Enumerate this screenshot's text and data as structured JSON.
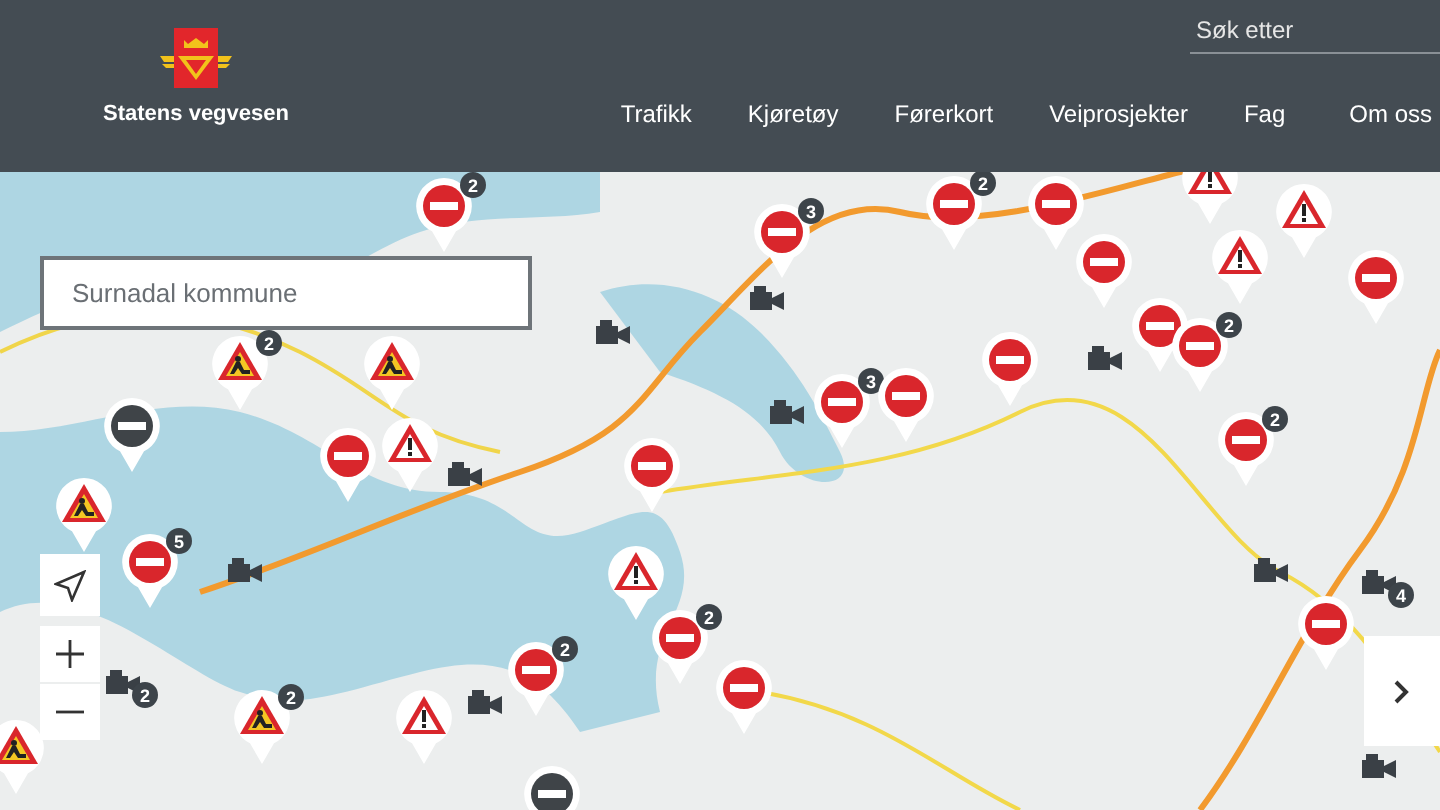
{
  "header": {
    "brand": "Statens vegvesen",
    "search": {
      "placeholder": "Søk etter"
    },
    "nav": [
      {
        "label": "Trafikk"
      },
      {
        "label": "Kjøretøy"
      },
      {
        "label": "Førerkort"
      },
      {
        "label": "Veiprosjekter"
      },
      {
        "label": "Fag"
      },
      {
        "label": "Om oss"
      }
    ]
  },
  "map": {
    "search": {
      "placeholder": "Surnadal kommune"
    },
    "markers": [
      {
        "kind": "closed",
        "count": "2"
      },
      {
        "kind": "closed",
        "count": "3"
      },
      {
        "kind": "closed",
        "count": "2"
      },
      {
        "kind": "closed"
      },
      {
        "kind": "warning"
      },
      {
        "kind": "closed"
      },
      {
        "kind": "closed"
      },
      {
        "kind": "warning"
      },
      {
        "kind": "warning"
      },
      {
        "kind": "closed"
      },
      {
        "kind": "closed",
        "count": "2"
      },
      {
        "kind": "closed",
        "count": "2"
      },
      {
        "kind": "roadwork",
        "count": "2"
      },
      {
        "kind": "roadwork"
      },
      {
        "kind": "warning"
      },
      {
        "kind": "closed-dark"
      },
      {
        "kind": "closed"
      },
      {
        "kind": "closed"
      },
      {
        "kind": "closed"
      },
      {
        "kind": "closed",
        "count": "3"
      },
      {
        "kind": "closed"
      },
      {
        "kind": "warning"
      },
      {
        "kind": "closed",
        "count": "2"
      },
      {
        "kind": "closed"
      },
      {
        "kind": "closed",
        "count": "2"
      },
      {
        "kind": "closed",
        "count": "5"
      },
      {
        "kind": "roadwork"
      },
      {
        "kind": "roadwork",
        "count": "2"
      },
      {
        "kind": "warning"
      },
      {
        "kind": "roadwork"
      },
      {
        "kind": "closed-dark"
      },
      {
        "kind": "closed"
      },
      {
        "kind": "camera"
      },
      {
        "kind": "camera"
      },
      {
        "kind": "camera"
      },
      {
        "kind": "camera"
      },
      {
        "kind": "camera"
      },
      {
        "kind": "camera"
      },
      {
        "kind": "camera"
      },
      {
        "kind": "camera",
        "count": "2"
      },
      {
        "kind": "camera",
        "count": "4"
      },
      {
        "kind": "camera"
      },
      {
        "kind": "camera"
      }
    ]
  }
}
